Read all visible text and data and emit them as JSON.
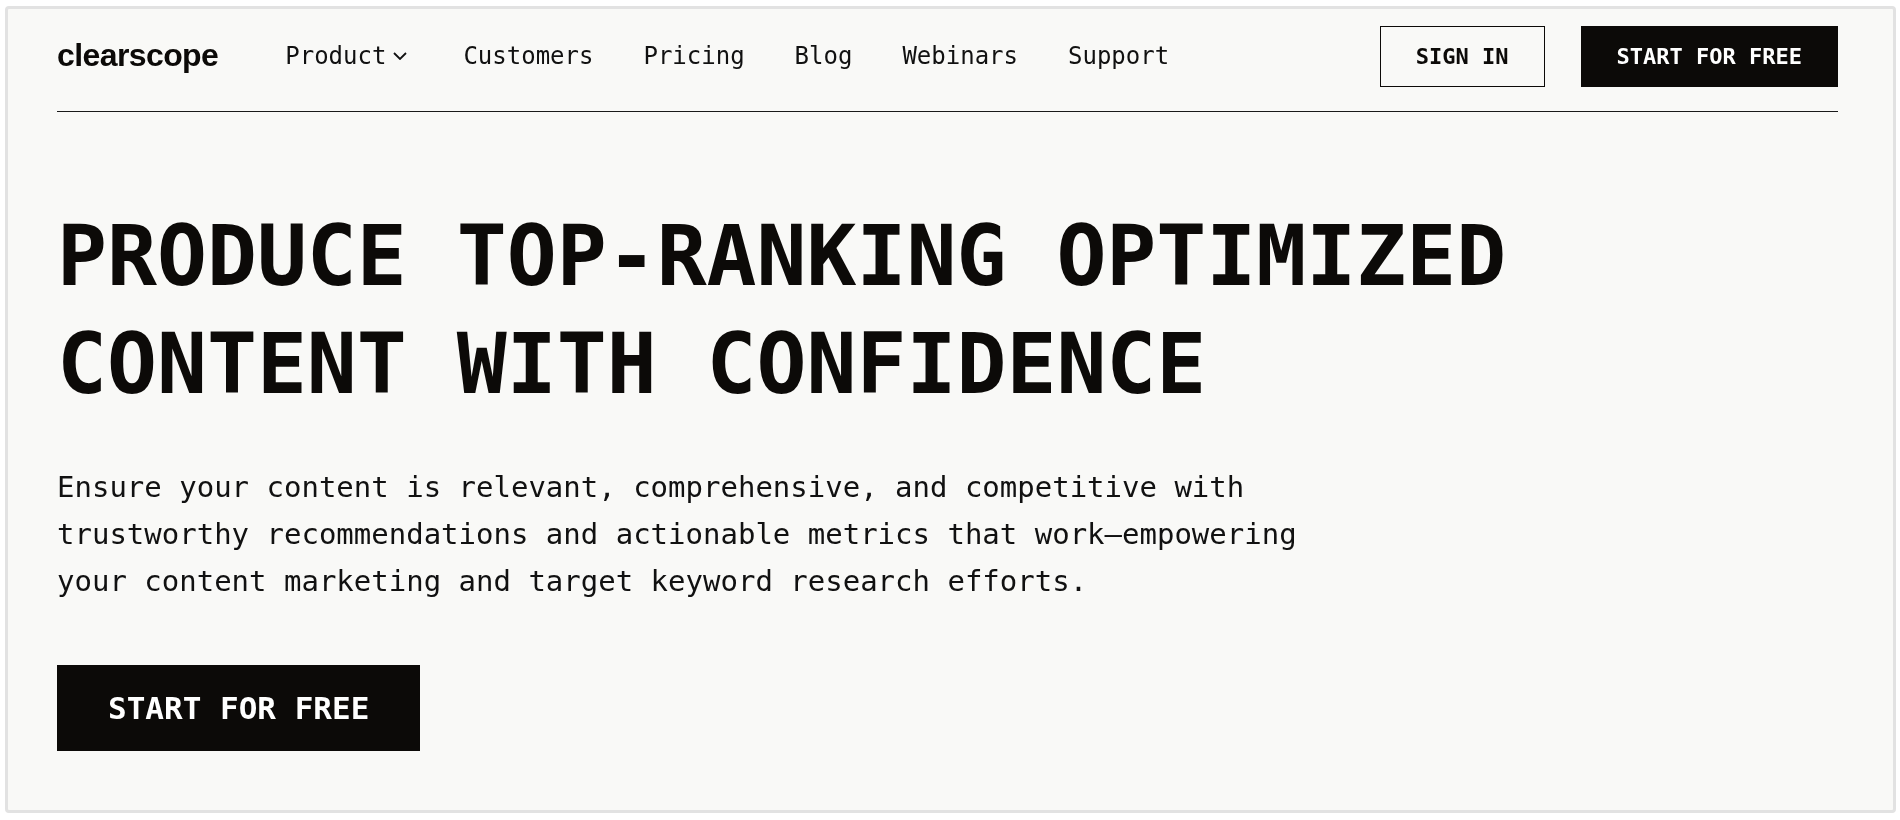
{
  "header": {
    "logo": "clearscope",
    "nav": [
      {
        "label": "Product",
        "kind": "dropdown"
      },
      {
        "label": "Customers",
        "kind": "link"
      },
      {
        "label": "Pricing",
        "kind": "link"
      },
      {
        "label": "Blog",
        "kind": "link"
      },
      {
        "label": "Webinars",
        "kind": "link"
      },
      {
        "label": "Support",
        "kind": "link"
      }
    ],
    "actions": [
      {
        "label": "SIGN IN",
        "kind": "outline"
      },
      {
        "label": "START FOR FREE",
        "kind": "solid"
      }
    ]
  },
  "hero": {
    "headline": "PRODUCE TOP-RANKING OPTIMIZED CONTENT WITH CONFIDENCE",
    "description": "Ensure your content is relevant, comprehensive, and competitive with trustworthy recommendations and actionable metrics that work—empowering your content marketing and target keyword research efforts.",
    "cta": {
      "label": "START FOR FREE"
    }
  }
}
